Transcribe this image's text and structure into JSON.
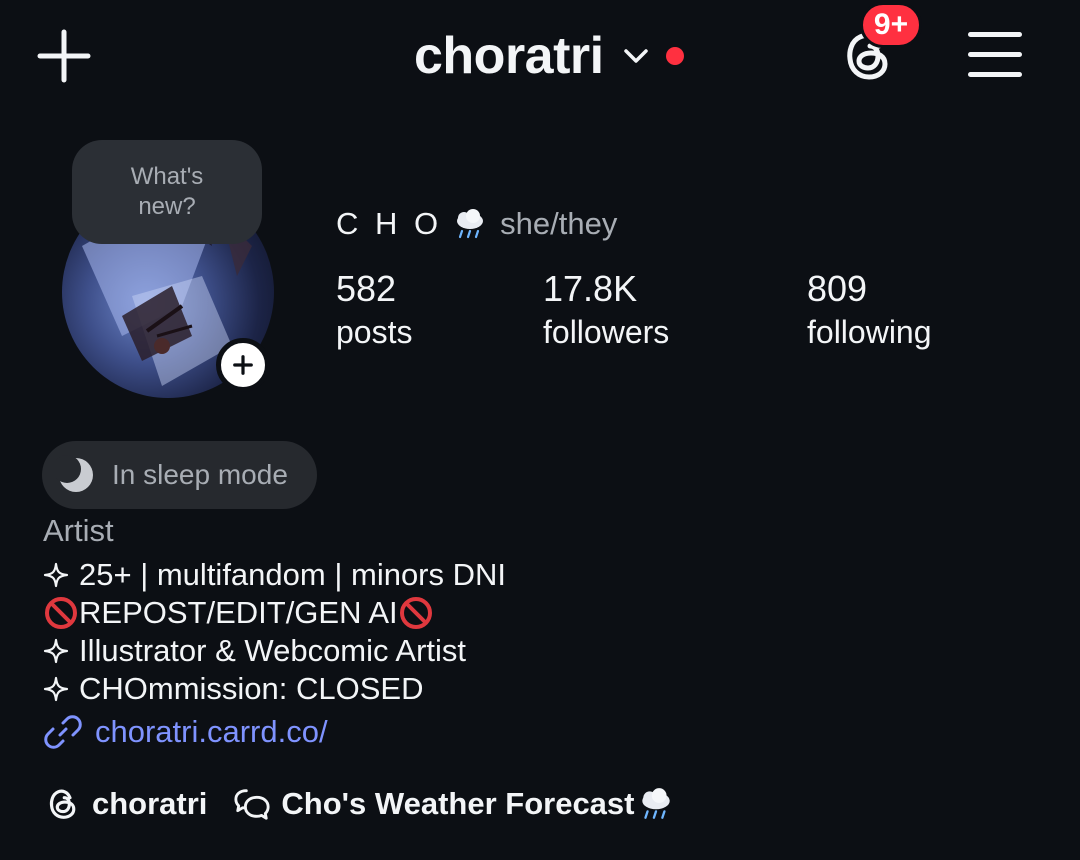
{
  "header": {
    "username": "choratri",
    "notification_badge": "9+",
    "icons": {
      "create": "plus-icon",
      "account_switch": "chevron-down-icon",
      "threads": "threads-icon",
      "menu": "hamburger-menu-icon"
    }
  },
  "profile": {
    "note_bubble": "What's new?",
    "display_name": "C H O",
    "pronouns": "she/they",
    "stats": {
      "posts": {
        "value": "582",
        "label": "posts"
      },
      "followers": {
        "value": "17.8K",
        "label": "followers"
      },
      "following": {
        "value": "809",
        "label": "following"
      }
    }
  },
  "status": {
    "sleep_label": "In sleep mode"
  },
  "bio": {
    "category": "Artist",
    "lines": [
      "25+ | multifandom | minors DNI",
      "REPOST/EDIT/GEN AI",
      "Illustrator & Webcomic Artist",
      "CHOmmission: CLOSED"
    ],
    "link": "choratri.carrd.co/"
  },
  "bottom_chips": {
    "threads_handle": "choratri",
    "channel_name": "Cho's Weather Forecast"
  },
  "colors": {
    "background": "#0c0f14",
    "text": "#f3f5f7",
    "muted_text": "#a8adb4",
    "link": "#7f93ff",
    "badge": "#ff3040",
    "chip_bg": "#26292e"
  }
}
